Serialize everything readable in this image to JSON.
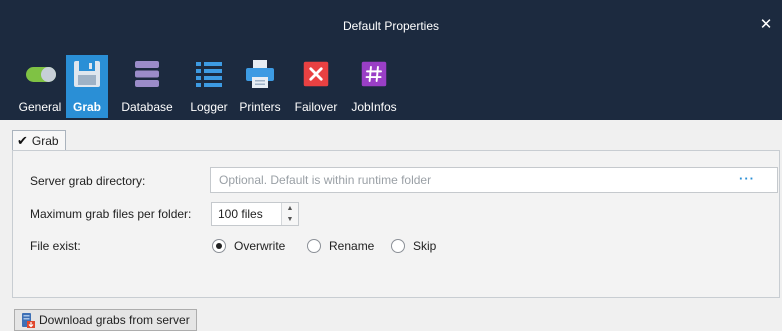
{
  "window": {
    "title": "Default Properties",
    "close_icon": "close-icon"
  },
  "tabs": [
    {
      "label": "General",
      "icon": "toggle-icon",
      "active": false
    },
    {
      "label": "Grab",
      "icon": "save-icon",
      "active": true
    },
    {
      "label": "Database",
      "icon": "database-icon",
      "active": false
    },
    {
      "label": "Logger",
      "icon": "list-icon",
      "active": false
    },
    {
      "label": "Printers",
      "icon": "printer-icon",
      "active": false
    },
    {
      "label": "Failover",
      "icon": "failover-x-icon",
      "active": false
    },
    {
      "label": "JobInfos",
      "icon": "hash-icon",
      "active": false
    }
  ],
  "grab_section": {
    "checkbox_label": "Grab",
    "checked": true,
    "server_dir_label": "Server grab directory:",
    "server_dir_value": "",
    "server_dir_placeholder": "Optional. Default is within runtime folder",
    "browse_label": "···",
    "max_files_label": "Maximum grab files per folder:",
    "max_files_value": "100 files",
    "file_exist_label": "File exist:",
    "file_exist_options": [
      {
        "label": "Overwrite",
        "selected": true
      },
      {
        "label": "Rename",
        "selected": false
      },
      {
        "label": "Skip",
        "selected": false
      }
    ]
  },
  "download_button": {
    "label": "Download grabs from server",
    "icon": "download-server-icon"
  },
  "colors": {
    "header_bg": "#1c2a3f",
    "active_tab": "#2a8fd6",
    "accent": "#2a8fd6"
  }
}
